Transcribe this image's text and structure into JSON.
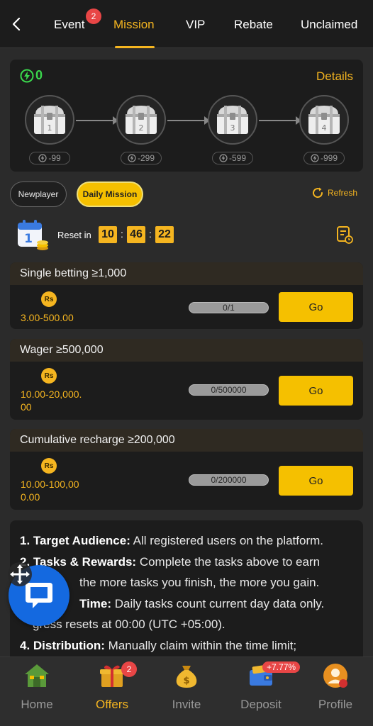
{
  "topnav": {
    "tabs": [
      {
        "label": "Event",
        "badge": "2"
      },
      {
        "label": "Mission",
        "active": true
      },
      {
        "label": "VIP"
      },
      {
        "label": "Rebate"
      },
      {
        "label": "Unclaimed"
      }
    ]
  },
  "chest_panel": {
    "energy": "0",
    "details_label": "Details",
    "chests": [
      {
        "number": "1",
        "cost": "-99"
      },
      {
        "number": "2",
        "cost": "-299"
      },
      {
        "number": "3",
        "cost": "-599"
      },
      {
        "number": "4",
        "cost": "-999"
      }
    ]
  },
  "filters": {
    "newplayer": "Newplayer",
    "daily": "Daily Mission",
    "refresh": "Refresh"
  },
  "reset": {
    "label": "Reset in",
    "hh": "10",
    "mm": "46",
    "ss": "22"
  },
  "tasks": [
    {
      "title": "Single betting ≥1,000",
      "currency": "Rs",
      "reward": "3.00-500.00",
      "progress": "0/1",
      "button": "Go"
    },
    {
      "title": "Wager ≥500,000",
      "currency": "Rs",
      "reward": "10.00-20,000.00",
      "progress": "0/500000",
      "button": "Go"
    },
    {
      "title": "Cumulative recharge ≥200,000",
      "currency": "Rs",
      "reward": "10.00-100,000.00",
      "progress": "0/200000",
      "button": "Go"
    }
  ],
  "rules": {
    "r1_head": "1. Target Audience:",
    "r1_text": " All registered users on the platform.",
    "r2_head": "2. Tasks & Rewards:",
    "r2_text": " Complete the tasks above to earn",
    "r2_text2": " the more tasks you finish, the more you gain.",
    "r3_head": "Time:",
    "r3_text": " Daily tasks count current day data only.",
    "r3_text2": "gress resets at 00:00 (UTC +05:00).",
    "r4_head": "4. Distribution:",
    "r4_text": " Manually claim within the time limit;"
  },
  "bottomnav": {
    "items": [
      {
        "label": "Home"
      },
      {
        "label": "Offers",
        "badge": "2",
        "active": true
      },
      {
        "label": "Invite"
      },
      {
        "label": "Deposit",
        "tag": "+7.77%"
      },
      {
        "label": "Profile"
      }
    ]
  },
  "colors": {
    "accent": "#f5b520",
    "energy": "#3ad64c",
    "badge": "#e84646",
    "chat": "#1469e0"
  }
}
